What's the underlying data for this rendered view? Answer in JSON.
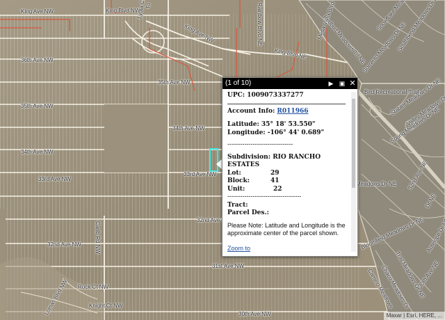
{
  "map": {
    "road_labels": [
      "King Ave NW",
      "King Blvd NW",
      "Lydia Ct",
      "To",
      "Rainbow Blvd NE",
      "King Ave NW",
      "King Blvd NE",
      "Mesa Vista Blvd",
      "Redbud Meadows Trl NE",
      "Sorrento Meadows Dr NE",
      "Snowflake Meadows Trl NE",
      "Southbend Meadows Dr NE",
      "36th Ave NW",
      "35th Ave NW",
      "35th Ave NW",
      "34th Ave NW",
      "34th Ave NW",
      "33rd Ave NW",
      "33rd Ave NW",
      "32nd Ave NW",
      "Carib Rd NW",
      "32nd Ave NW",
      "31st Ave NW",
      "Rock Ct NW",
      "Knight Ct NW",
      "30th Ave NW",
      "Lomas Blvd NW",
      "Stabler Meadows Dr NE",
      "Valley Meadows Dr NE",
      "Spring Meadows Dr NE",
      "Meadows Dr NE",
      "32nd Ave NE",
      "Bloomfield Meadows Dr NE",
      "Dr NE",
      "Camino Meadows",
      "Chaco Meadows Dr",
      "Trail Meadows Dr NE",
      "Antelope Dr NE",
      "Bird Recreational Trail",
      "30th Ave NE"
    ],
    "attribution": "Maxar | Esri, HERE, ..."
  },
  "popup": {
    "counter": "(1 of 10)",
    "next_icon": "triangle-right-icon",
    "maximize_icon": "maximize-icon",
    "close_icon": "close-icon",
    "upc": "UPC: 1009073337277",
    "account_label": "Account Info: ",
    "account_link": "R011966",
    "latitude": "Latitude: 35° 18' 53.550\"",
    "longitude": "Longitude: -106° 44' 0.689\"",
    "separator": "-------------------------------",
    "subdivision_label": "Subdivision:",
    "subdivision_value": "RIO RANCHO ESTATES",
    "lot_label": "Lot:",
    "lot_value": "29",
    "block_label": "Block:",
    "block_value": "41",
    "unit_label": "Unit:",
    "unit_value": "22",
    "separator2": "-----------------------------------",
    "tract_label": "Tract:",
    "parcel_label": "Parcel Des.:",
    "note": "Please Note: Latitude and Longitude is the approximate center of the parcel shown.",
    "zoom_link": "Zoom to"
  },
  "colors": {
    "popup_title_bg": "#000000",
    "link": "#1f4fa0",
    "selected_parcel": "#3ee8e0",
    "boundary_red": "#d9583f"
  }
}
